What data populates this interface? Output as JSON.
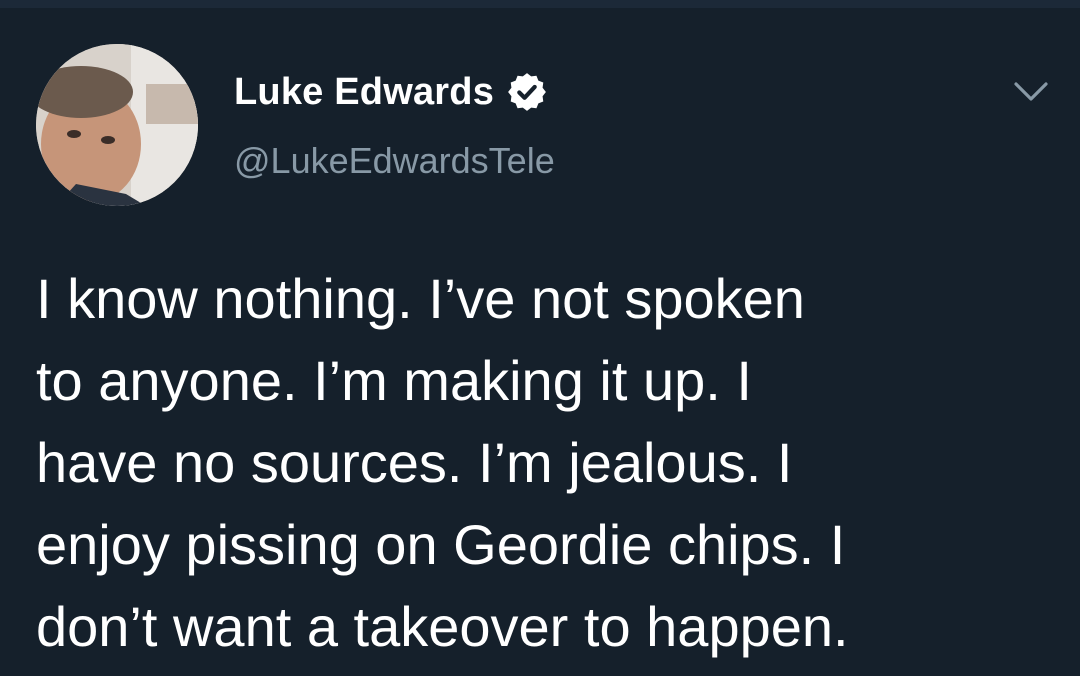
{
  "tweet": {
    "author": {
      "display_name": "Luke Edwards",
      "handle": "@LukeEdwardsTele",
      "verified": true
    },
    "text_lines": [
      "I know nothing. I’ve not spoken",
      "to anyone. I’m making it up. I",
      "have no sources. I’m jealous. I",
      "enjoy pissing on Geordie chips. I",
      "don’t want a takeover to happen."
    ]
  },
  "icons": {
    "verified": "verified-badge-icon",
    "menu": "chevron-down-icon"
  },
  "colors": {
    "background": "#15202b",
    "primary_text": "#ffffff",
    "secondary_text": "#8899a6"
  }
}
